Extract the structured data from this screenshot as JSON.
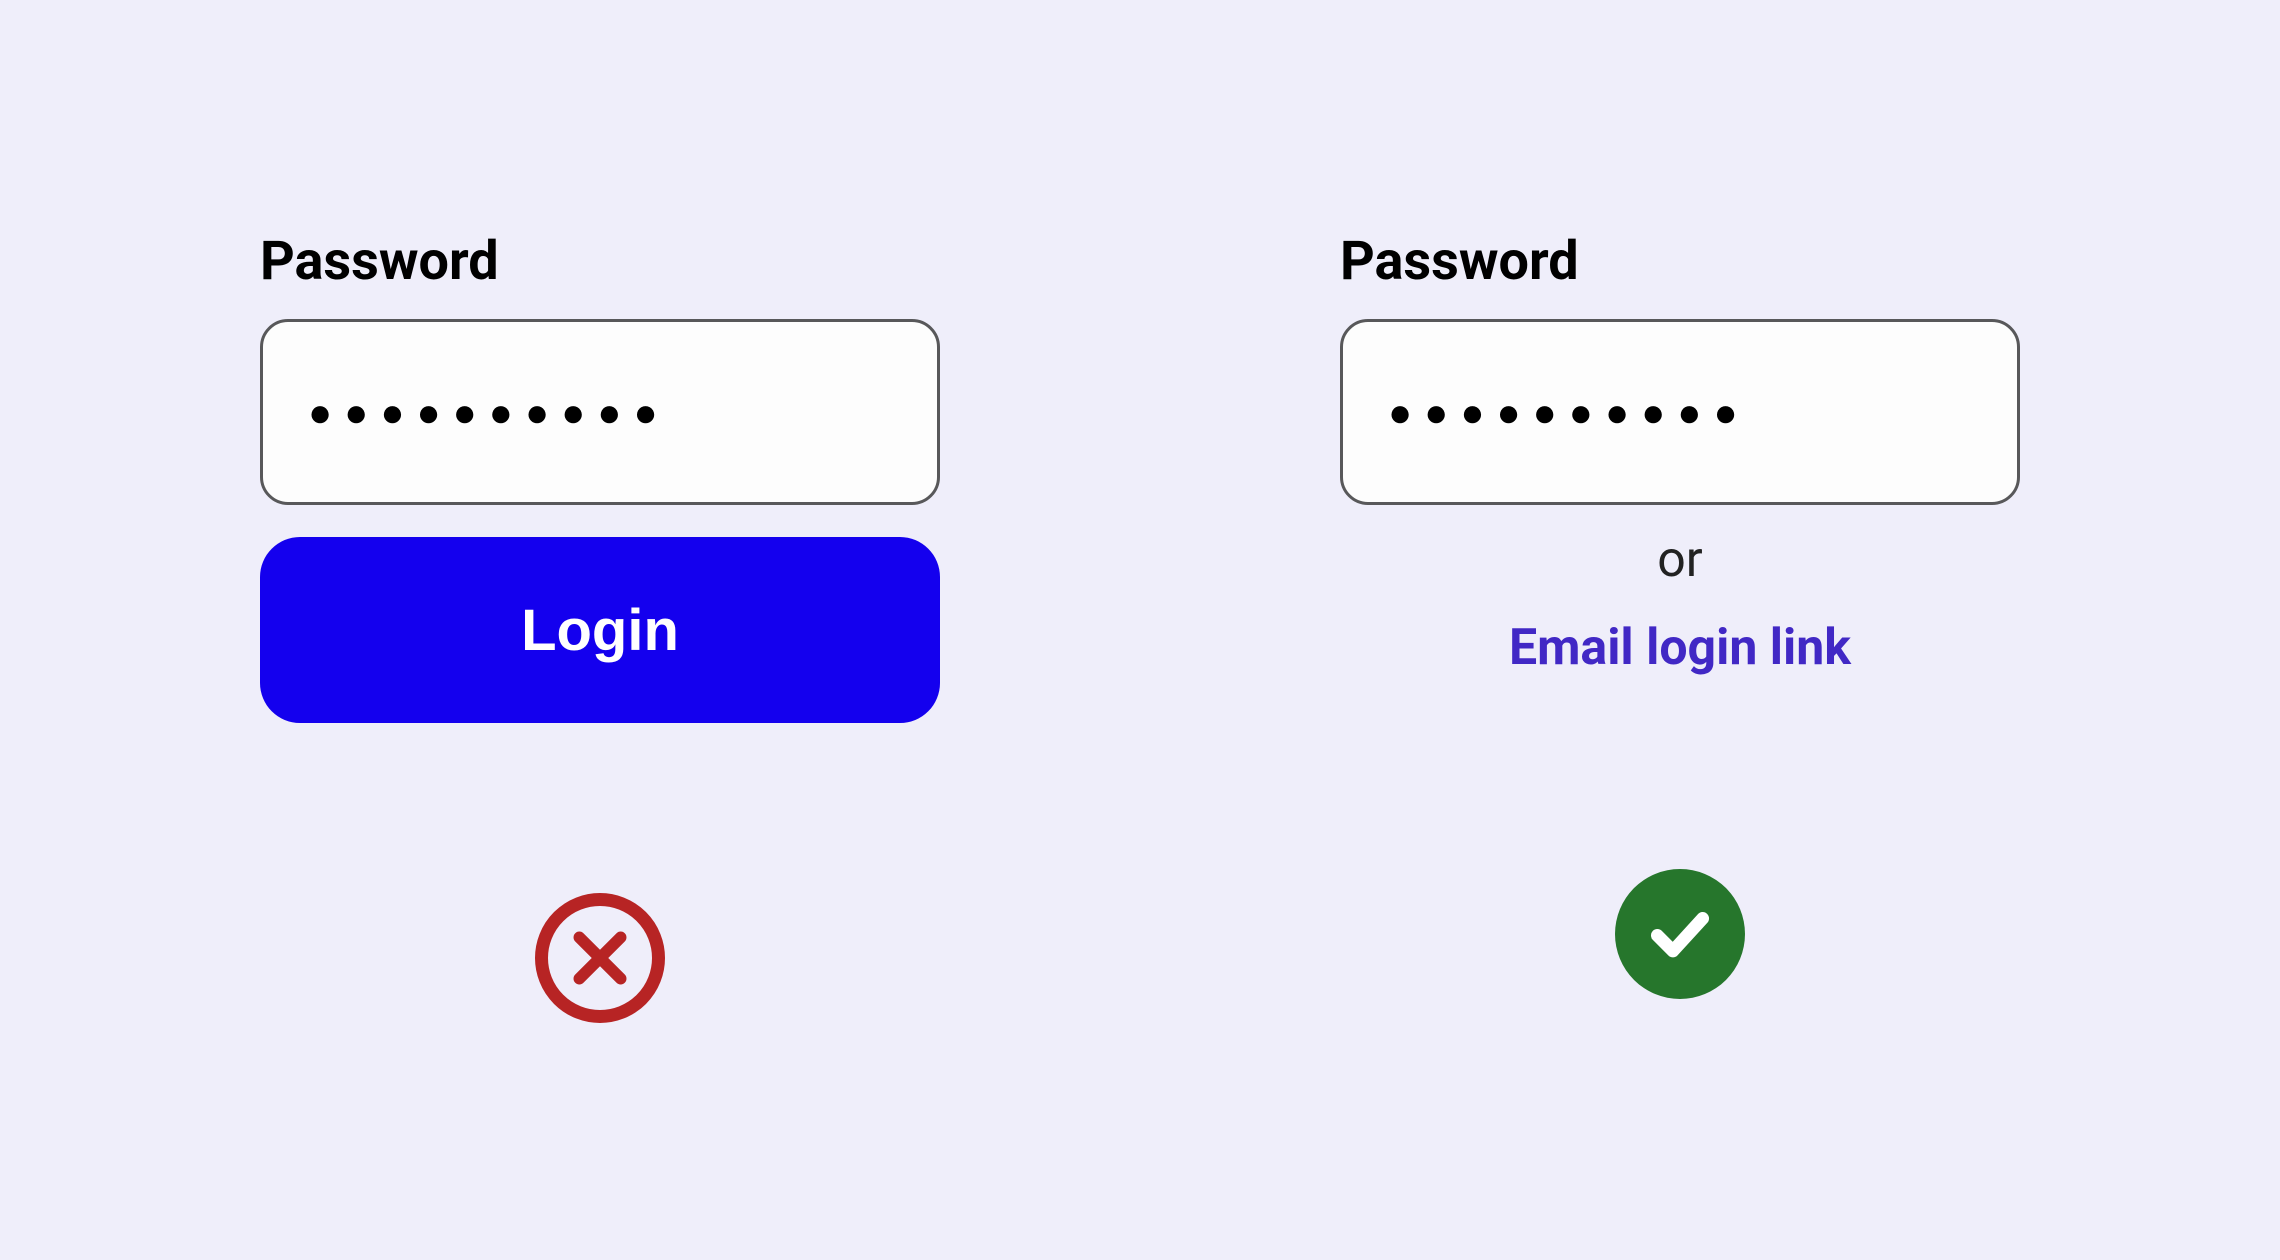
{
  "left": {
    "label": "Password",
    "masked_value": "●●●●●●●●●●",
    "login_button": "Login"
  },
  "right": {
    "label": "Password",
    "masked_value": "●●●●●●●●●●",
    "or_text": "or",
    "email_link": "Email login link"
  }
}
